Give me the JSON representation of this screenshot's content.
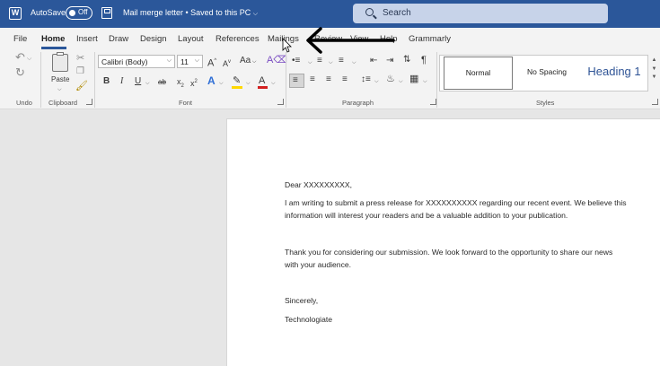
{
  "titlebar": {
    "autosave_label": "AutoSave",
    "autosave_state": "Off",
    "doc_title": "Mail merge letter • Saved to this PC",
    "search_placeholder": "Search"
  },
  "tabs": [
    "File",
    "Home",
    "Insert",
    "Draw",
    "Design",
    "Layout",
    "References",
    "Mailings",
    "Review",
    "View",
    "Help",
    "Grammarly"
  ],
  "active_tab": "Home",
  "ribbon": {
    "groups": {
      "undo": "Undo",
      "clipboard": "Clipboard",
      "font": "Font",
      "paragraph": "Paragraph",
      "styles": "Styles"
    },
    "paste_label": "Paste",
    "font_name": "Calibri (Body)",
    "font_size": "11",
    "grow_font": "A",
    "shrink_font": "A",
    "change_case": "Aa",
    "bold": "B",
    "italic": "I",
    "underline": "U",
    "strike": "ab",
    "subscript": "x",
    "superscript": "x",
    "text_effects": "A",
    "font_color": "A",
    "styles": [
      "Normal",
      "No Spacing",
      "Heading 1"
    ]
  },
  "document": {
    "salutation": "Dear XXXXXXXXX,",
    "para1_line1": "I am writing to submit a press release for XXXXXXXXXX regarding our recent event. We believe this",
    "para1_line2": "information will interest your readers and be a valuable addition to your publication.",
    "para2_line1": "Thank you for considering our submission. We look forward to the opportunity to share our news",
    "para2_line2": "with your audience.",
    "closing": "Sincerely,",
    "signature": "Technologiate"
  },
  "colors": {
    "title_bar": "#2b579a",
    "highlight_yellow": "#ffd800",
    "font_red": "#d32020",
    "heading_blue": "#2f5496"
  }
}
